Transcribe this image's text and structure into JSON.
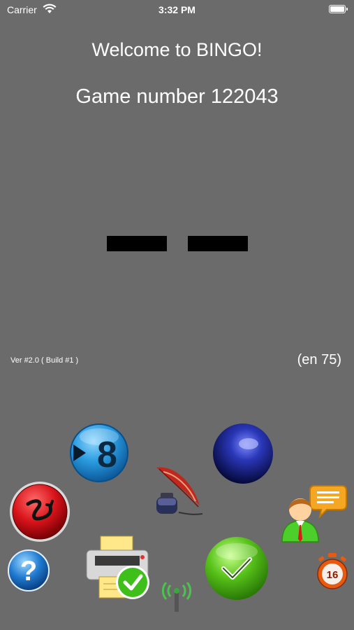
{
  "status_bar": {
    "carrier": "Carrier",
    "time": "3:32 PM"
  },
  "main": {
    "welcome": "Welcome to BINGO!",
    "game_number": "Game number 122043",
    "version": "Ver #2.0 ( Build #1 )",
    "language_count": "(en 75)"
  },
  "buttons": {
    "next_number_digit": "8",
    "timer_value": "16"
  },
  "colors": {
    "background": "#6b6b6b",
    "next_button": "#2a9be0",
    "stop_button": "#d8141a",
    "check_button": "#58c21a",
    "ball_button": "#1d2a9a"
  },
  "icons": [
    "wifi-icon",
    "battery-icon",
    "next-number-icon",
    "blue-ball-icon",
    "stop-icon",
    "quill-ink-icon",
    "chat-person-icon",
    "help-icon",
    "printer-check-icon",
    "antenna-icon",
    "checkmark-icon",
    "timer-icon"
  ]
}
